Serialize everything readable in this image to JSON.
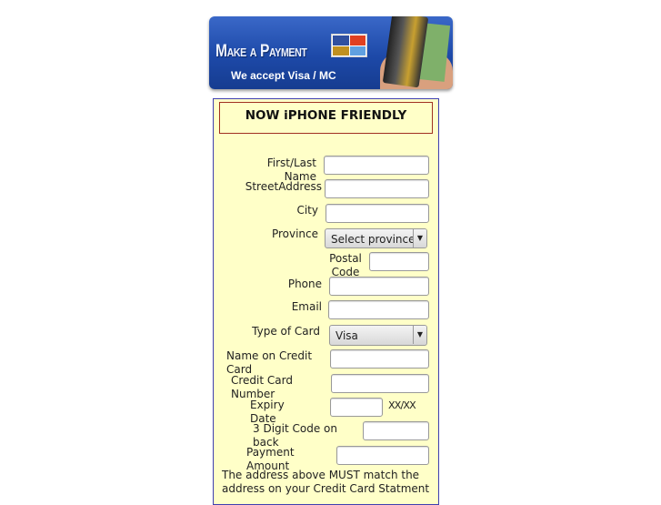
{
  "banner": {
    "title": "Make a Payment",
    "subtitle": "We accept Visa / MC",
    "card_logos": [
      "visa-logo",
      "mastercard-logo",
      "discover-logo",
      "amex-logo"
    ]
  },
  "notice": "NOW iPHONE FRIENDLY",
  "fields": {
    "name": "First/Last Name",
    "street": "StreetAddress",
    "city": "City",
    "province": "Province",
    "province_value": "Select province",
    "postal": "Postal Code",
    "phone": "Phone",
    "email": "Email",
    "card_type": "Type of Card",
    "card_type_value": "Visa",
    "card_name": "Name on Credit Card",
    "card_number": "Credit Card Number",
    "expiry": "Expiry Date",
    "expiry_hint": "XX/XX",
    "cvv": "3 Digit Code on back",
    "amount": "Payment Amount"
  },
  "footer_note": "The address above MUST match the address on your Credit Card Statment"
}
